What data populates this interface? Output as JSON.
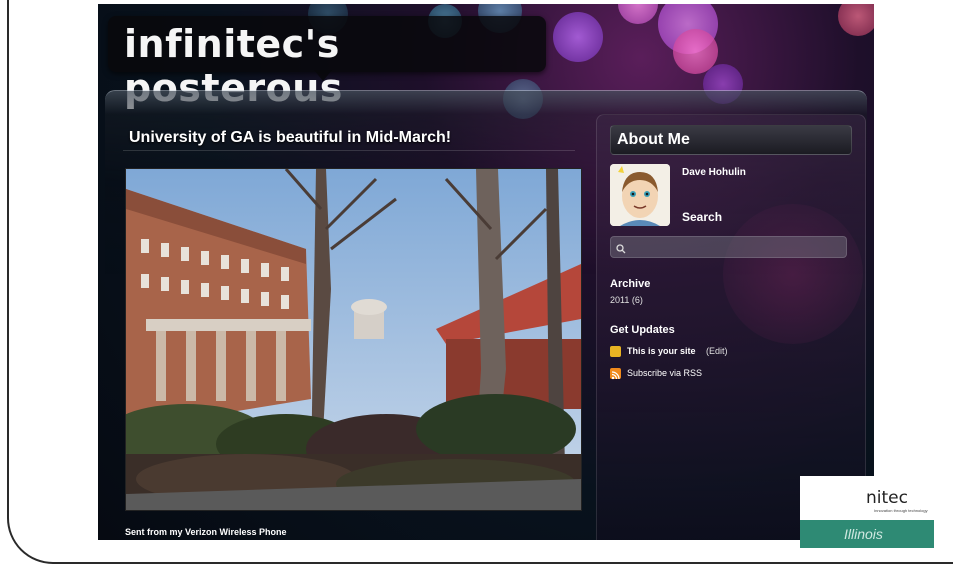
{
  "blog": {
    "title": "infinitec's posterous"
  },
  "post": {
    "title": "University of GA is beautiful in Mid-March!",
    "caption": "Sent from my Verizon Wireless Phone"
  },
  "sidebar": {
    "about_heading": "About Me",
    "author_name": "Dave Hohulin",
    "search_label": "Search",
    "search_placeholder": "",
    "archive_heading": "Archive",
    "archive_entry": "2011 (6)",
    "updates_heading": "Get Updates",
    "site_link": "This is your site",
    "edit_link": "(Edit)",
    "rss_link": "Subscribe via RSS"
  },
  "logo": {
    "text": "nitec",
    "tagline": "Innovation through technology",
    "bar_text": "Illinois"
  },
  "colors": {
    "logo_bar": "#2e8a74",
    "rss_icon": "#f08a1c",
    "posterous_icon": "#e8b323"
  },
  "icons": [
    "search-icon",
    "posterous-icon",
    "rss-icon"
  ]
}
